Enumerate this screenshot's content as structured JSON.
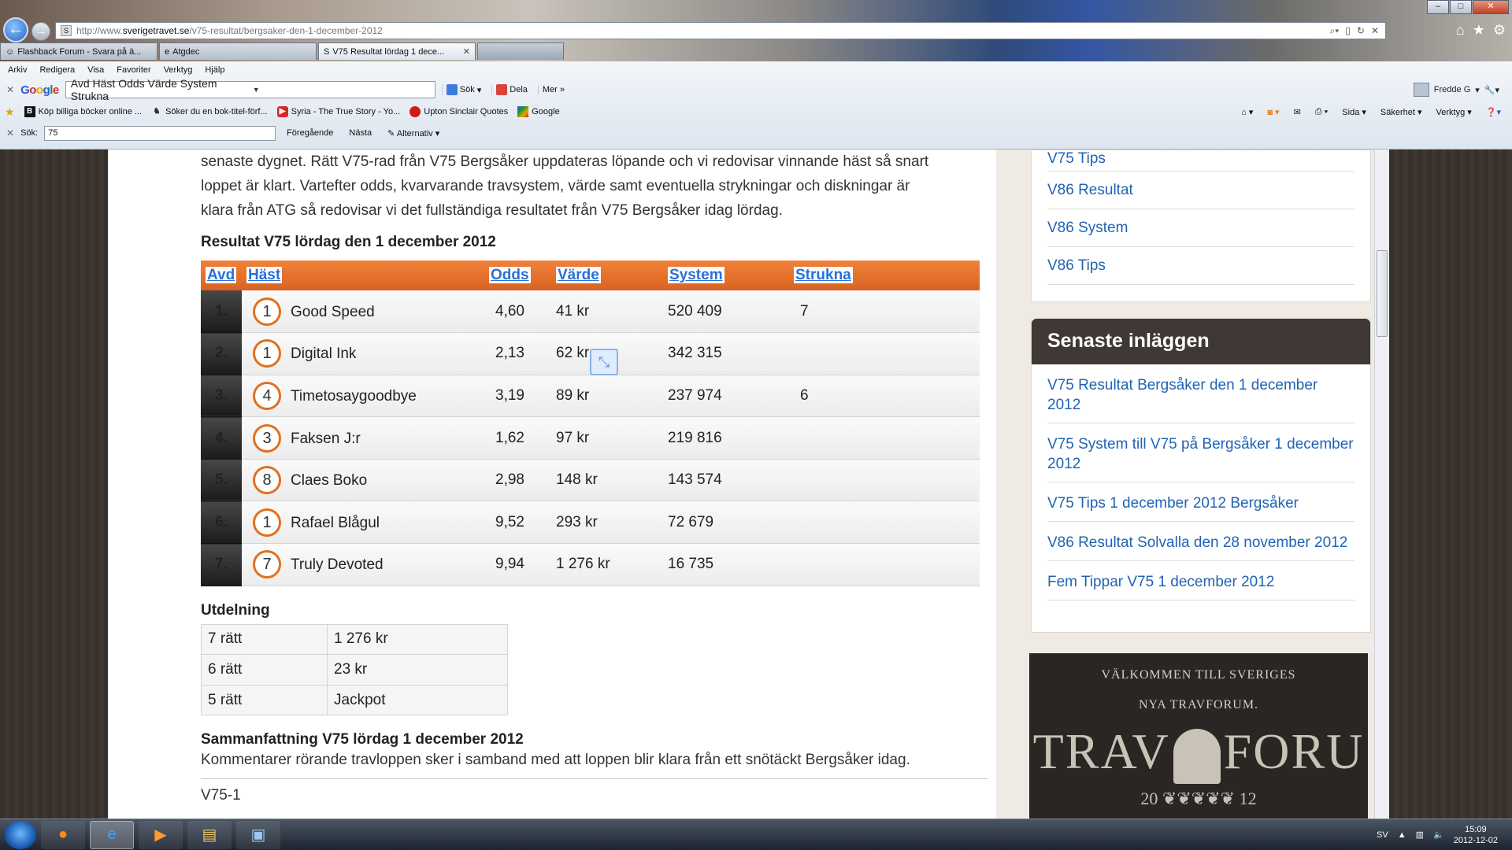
{
  "browser": {
    "url_prefix": "http://www.",
    "url_domain": "sverigetravet.se",
    "url_path": "/v75-resultat/bergsaker-den-1-december-2012",
    "tabs": [
      {
        "label": "Flashback Forum - Svara på ä..."
      },
      {
        "label": "Atgdec"
      },
      {
        "label": "V75 Resultat lördag 1 dece..."
      }
    ],
    "menu": [
      "Arkiv",
      "Redigera",
      "Visa",
      "Favoriter",
      "Verktyg",
      "Hjälp"
    ],
    "google_search_value": "Avd Häst Odds Värde System Strukna",
    "google_buttons": {
      "search": "Sök",
      "share": "Dela",
      "more": "Mer"
    },
    "user_name": "Fredde G",
    "favorites": [
      "Köp billiga böcker online ...",
      "Söker du en bok-titel-förf...",
      "Syria - The True Story - Yo...",
      "Upton Sinclair Quotes",
      "Google"
    ],
    "command_bar": [
      "Sida",
      "Säkerhet",
      "Verktyg"
    ],
    "find": {
      "label": "Sök:",
      "value": "75",
      "prev": "Föregående",
      "next": "Nästa",
      "options": "Alternativ"
    }
  },
  "article": {
    "intro_lines": [
      "senaste dygnet. Rätt V75-rad från V75 Bergsåker uppdateras löpande och vi redovisar vinnande häst så snart",
      "loppet är klart. Vartefter odds, kvarvarande travsystem, värde samt eventuella strykningar och diskningar är",
      "klara från ATG så redovisar vi det fullständiga resultatet från V75 Bergsåker idag lördag."
    ],
    "results_heading": "Resultat V75 lördag den 1 december 2012",
    "table_headers": {
      "avd": "Avd",
      "hast": "Häst",
      "odds": "Odds",
      "varde": "Värde",
      "system": "System",
      "strukna": "Strukna"
    },
    "rows": [
      {
        "avd": "1.",
        "num": "1",
        "horse": "Good Speed",
        "odds": "4,60",
        "varde": "41 kr",
        "system": "520 409",
        "strukna": "7"
      },
      {
        "avd": "2.",
        "num": "1",
        "horse": "Digital Ink",
        "odds": "2,13",
        "varde": "62 kr",
        "system": "342 315",
        "strukna": ""
      },
      {
        "avd": "3.",
        "num": "4",
        "horse": "Timetosaygoodbye",
        "odds": "3,19",
        "varde": "89 kr",
        "system": "237 974",
        "strukna": "6"
      },
      {
        "avd": "4.",
        "num": "3",
        "horse": "Faksen J:r",
        "odds": "1,62",
        "varde": "97 kr",
        "system": "219 816",
        "strukna": ""
      },
      {
        "avd": "5.",
        "num": "8",
        "horse": "Claes Boko",
        "odds": "2,98",
        "varde": "148 kr",
        "system": "143 574",
        "strukna": ""
      },
      {
        "avd": "6.",
        "num": "1",
        "horse": "Rafael Blågul",
        "odds": "9,52",
        "varde": "293 kr",
        "system": "72 679",
        "strukna": ""
      },
      {
        "avd": "7.",
        "num": "7",
        "horse": "Truly Devoted",
        "odds": "9,94",
        "varde": "1 276 kr",
        "system": "16 735",
        "strukna": ""
      }
    ],
    "payout_heading": "Utdelning",
    "payouts": [
      {
        "label": "7 rätt",
        "value": "1 276 kr"
      },
      {
        "label": "6 rätt",
        "value": "23 kr"
      },
      {
        "label": "5 rätt",
        "value": "Jackpot"
      }
    ],
    "summary_heading": "Sammanfattning V75 lördag 1 december 2012",
    "summary_text": "Kommentarer rörande travloppen sker i samband med att loppen blir klara från ett snötäckt Bergsåker idag.",
    "next_section": "V75-1"
  },
  "sidebar": {
    "links_top": [
      "V75 Tips",
      "V86 Resultat",
      "V86 System",
      "V86 Tips"
    ],
    "recent_heading": "Senaste inläggen",
    "recent_posts": [
      "V75 Resultat Bergsåker den 1 december 2012",
      "V75 System till V75 på Bergsåker 1 december 2012",
      "V75 Tips 1 december 2012 Bergsåker",
      "V86 Resultat Solvalla den 28 november 2012",
      "Fem Tippar V75 1 december 2012"
    ],
    "banner": {
      "line1": "VÄLKOMMEN TILL SVERIGES",
      "line2": "NYA TRAVFORUM.",
      "big_left": "TRAV",
      "big_right": "FORU",
      "year_left": "20",
      "year_right": "12"
    }
  },
  "taskbar": {
    "lang": "SV",
    "time": "15:09",
    "date": "2012-12-02"
  }
}
